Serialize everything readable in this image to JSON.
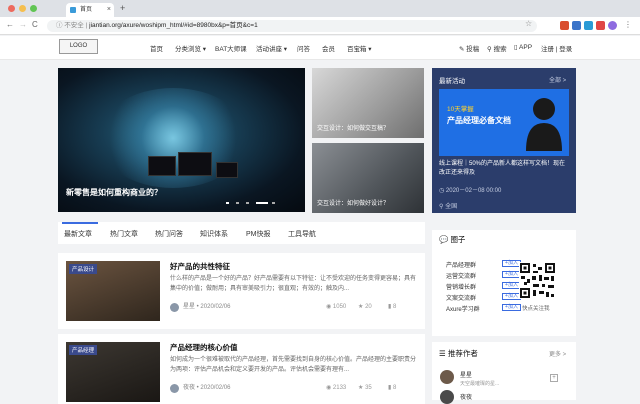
{
  "browser": {
    "tab_title": "首页",
    "tab_close": "×",
    "new_tab": "+",
    "back": "←",
    "forward": "→",
    "reload": "C",
    "security": "ⓘ 不安全 |",
    "url": "jiantian.org/axure/woshipm_html/#id=8980bx&p=首页&c=1",
    "bookmark": "☆"
  },
  "header": {
    "logo": "LOGO",
    "nav": [
      "首页",
      "分类浏览 ▾",
      "BAT大师课",
      "活动讲座 ▾",
      "问答",
      "会员",
      "百宝箱 ▾"
    ],
    "actions": [
      "投稿",
      "搜索",
      "APP",
      "注册 | 登录"
    ]
  },
  "hero": {
    "caption": "新零售是如何重构商业的？"
  },
  "side_items": [
    {
      "caption": "交互设计：如何做交互稿？"
    },
    {
      "caption": "交互设计：如何做好设计？"
    }
  ],
  "activity": {
    "title": "最新活动",
    "more": "全部 >",
    "banner_line1": "10天掌握",
    "banner_line2": "产品经理必备文档",
    "desc": "线上课程｜50%的产品新人都这样写文档！现在改正还来得及",
    "date": "2020－02－08 00:00",
    "location": "全国"
  },
  "tabs": [
    "最新文章",
    "热门文章",
    "热门问答",
    "知识体系",
    "PM快报",
    "工具导航"
  ],
  "articles": [
    {
      "badge": "产品设计",
      "title": "好产品的共性特征",
      "summary": "什么样的产品是一个好的产品？好产品需要有以下特征：让不受欢迎的任务变得更容易；具有集中的价值；做耐用；具有审美吸引力；很直观；有效的；触及内...",
      "author": "星星 • 2020/02/06",
      "views": "1050",
      "likes": "20",
      "saves": "8"
    },
    {
      "badge": "产品经理",
      "title": "产品经理的核心价值",
      "summary": "如何成为一个很难被取代的产品经理，首先需要找到自身的核心价值。产品经理的主要职责分为两项：评估产品机会和定义要开发的产品。评估机会需要有理有...",
      "author": "夜夜 • 2020/02/06",
      "views": "2133",
      "likes": "35",
      "saves": "8"
    }
  ],
  "circle": {
    "title": "圈子",
    "items": [
      "产品经理群",
      "运营交流群",
      "营销增长群",
      "文案交流群",
      "Axure学习群"
    ],
    "join_label": "+加入",
    "qr_caption": "快点关注我"
  },
  "authors": {
    "title": "推荐作者",
    "more": "更多 >",
    "list": [
      {
        "name": "星星",
        "desc": "天空最璀璨的星..."
      },
      {
        "name": "夜夜"
      }
    ],
    "add_label": "+"
  },
  "colors": {
    "accent": "#3a6be0",
    "activity_bg": "#2b3d6b",
    "banner_bg": "#1f6fe4",
    "banner_highlight": "#ffd22b"
  }
}
